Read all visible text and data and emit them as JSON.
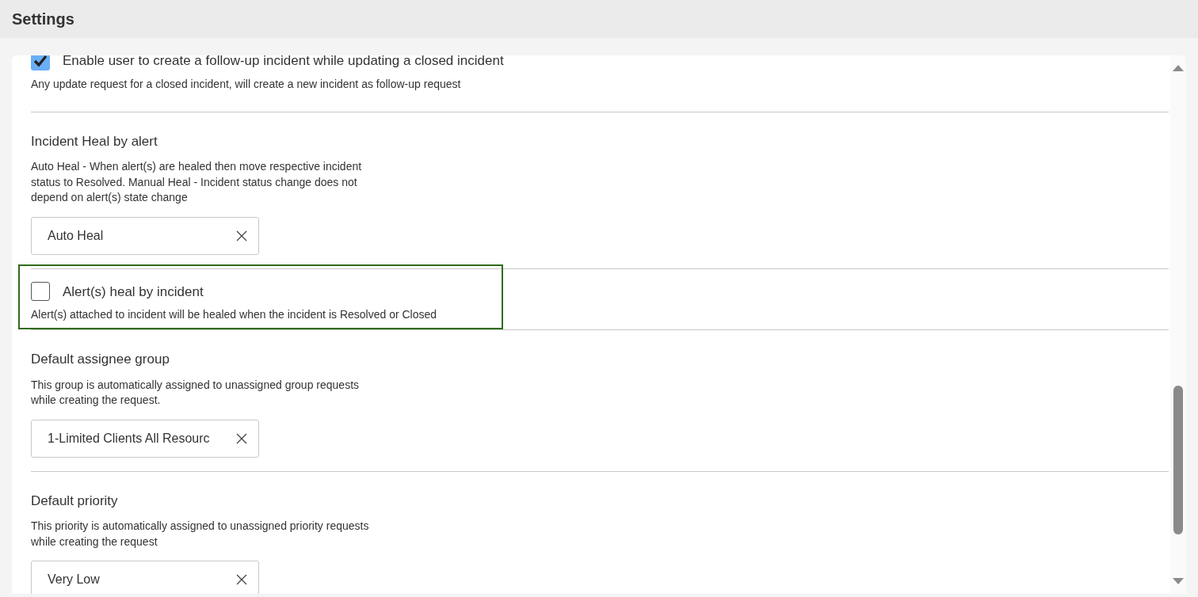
{
  "header": {
    "title": "Settings"
  },
  "sections": [
    {
      "kind": "checkbox",
      "checked": true,
      "highlighted": false,
      "label": "Enable user to create a follow-up incident while updating a closed incident",
      "description": "Any update request for a closed incident, will create a new incident as follow-up request"
    },
    {
      "kind": "select",
      "title": "Incident Heal by alert",
      "description": "Auto Heal - When alert(s) are healed then move respective incident status to Resolved. Manual Heal - Incident status change does not depend on alert(s) state change",
      "value": "Auto Heal"
    },
    {
      "kind": "checkbox",
      "checked": false,
      "highlighted": true,
      "label": "Alert(s) heal by incident",
      "description": "Alert(s) attached to incident will be healed when the incident is Resolved or Closed"
    },
    {
      "kind": "select",
      "title": "Default assignee group",
      "description": "This group is automatically assigned to unassigned group requests while creating the request.",
      "value": "1-Limited Clients All Resourc"
    },
    {
      "kind": "select",
      "title": "Default priority",
      "description": "This priority is automatically assigned to unassigned priority requests while creating the request",
      "value": "Very Low"
    }
  ]
}
